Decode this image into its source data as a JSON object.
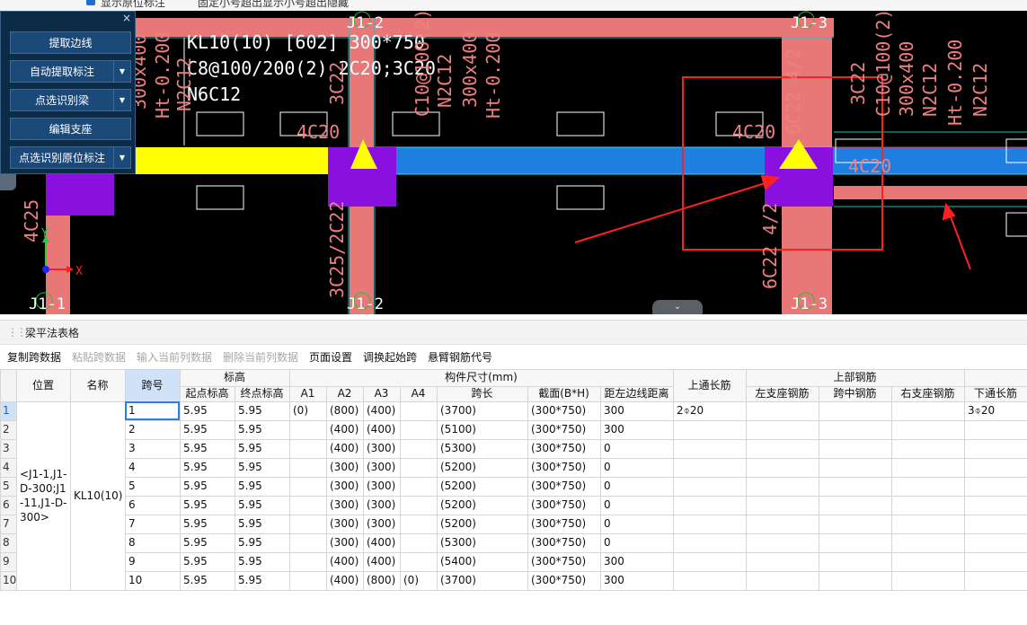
{
  "top_strip": {
    "checkbox_text": "显示原位标注",
    "text2": "固定小号超出显示小号超出隐藏"
  },
  "float_panel": {
    "buttons": [
      {
        "label": "提取边线",
        "dropdown": false
      },
      {
        "label": "自动提取标注",
        "dropdown": true
      },
      {
        "label": "点选识别梁",
        "dropdown": true
      },
      {
        "label": "编辑支座",
        "dropdown": false
      },
      {
        "label": "点选识别原位标注",
        "dropdown": true
      }
    ],
    "close_glyph": "×"
  },
  "cad": {
    "beam_text": [
      "KL10(10) [602] 300*750",
      "C8@100/200(2) 2C20;3C20",
      "N6C12"
    ],
    "axis_labels": [
      "J1-2",
      "J1-3",
      "J1-1",
      "J1-2",
      "J1-3"
    ],
    "rebar_labels": [
      "4C20",
      "4C20",
      "4C20",
      "4C25",
      "3C25/2C22",
      "6C22 4/2",
      "6C22 4/2",
      "3C22",
      "C10@100(2)",
      "N2C12",
      "300x400",
      "Ht-0.200",
      "300x400",
      "Ht-0.200",
      "N2C12",
      "3C22",
      "C10@100(2)",
      "300x400",
      "N2C12",
      "Ht-0.200",
      "N2C12"
    ],
    "axis_x": "X",
    "axis_y": "Y"
  },
  "panel": {
    "title": "梁平法表格",
    "collapse_glyph": "⌄",
    "side_glyph": "‹"
  },
  "toolbar": [
    {
      "label": "复制跨数据",
      "enabled": true
    },
    {
      "label": "粘贴跨数据",
      "enabled": false
    },
    {
      "label": "输入当前列数据",
      "enabled": false
    },
    {
      "label": "删除当前列数据",
      "enabled": false
    },
    {
      "label": "页面设置",
      "enabled": true
    },
    {
      "label": "调换起始跨",
      "enabled": true
    },
    {
      "label": "悬臂钢筋代号",
      "enabled": true
    }
  ],
  "table": {
    "group_headers": {
      "elevation": "标高",
      "dims": "构件尺寸(mm)",
      "top_rebar": "上部钢筋"
    },
    "headers": {
      "position": "位置",
      "name": "名称",
      "span": "跨号",
      "start_elev": "起点标高",
      "end_elev": "终点标高",
      "a1": "A1",
      "a2": "A2",
      "a3": "A3",
      "a4": "A4",
      "span_len": "跨长",
      "section": "截面(B*H)",
      "edge_dist": "距左边线距离",
      "top_through": "上通长筋",
      "left_support": "左支座钢筋",
      "mid_span": "跨中钢筋",
      "right_support": "右支座钢筋",
      "bottom_through": "下通长筋"
    },
    "position_value": "<J1-1,J1-D-300;J1-11,J1-D-300>",
    "name_value": "KL10(10)",
    "rows": [
      {
        "span": "1",
        "start": "5.95",
        "end": "5.95",
        "a1": "(0)",
        "a2": "(800)",
        "a3": "(400)",
        "a4": "",
        "len": "(3700)",
        "sec": "(300*750)",
        "dist": "300",
        "top": "2⌽20",
        "bottom": "3⌽20"
      },
      {
        "span": "2",
        "start": "5.95",
        "end": "5.95",
        "a1": "",
        "a2": "(400)",
        "a3": "(400)",
        "a4": "",
        "len": "(5100)",
        "sec": "(300*750)",
        "dist": "300",
        "top": "",
        "bottom": ""
      },
      {
        "span": "3",
        "start": "5.95",
        "end": "5.95",
        "a1": "",
        "a2": "(400)",
        "a3": "(300)",
        "a4": "",
        "len": "(5300)",
        "sec": "(300*750)",
        "dist": "0",
        "top": "",
        "bottom": ""
      },
      {
        "span": "4",
        "start": "5.95",
        "end": "5.95",
        "a1": "",
        "a2": "(300)",
        "a3": "(300)",
        "a4": "",
        "len": "(5200)",
        "sec": "(300*750)",
        "dist": "0",
        "top": "",
        "bottom": ""
      },
      {
        "span": "5",
        "start": "5.95",
        "end": "5.95",
        "a1": "",
        "a2": "(300)",
        "a3": "(300)",
        "a4": "",
        "len": "(5200)",
        "sec": "(300*750)",
        "dist": "0",
        "top": "",
        "bottom": ""
      },
      {
        "span": "6",
        "start": "5.95",
        "end": "5.95",
        "a1": "",
        "a2": "(300)",
        "a3": "(300)",
        "a4": "",
        "len": "(5200)",
        "sec": "(300*750)",
        "dist": "0",
        "top": "",
        "bottom": ""
      },
      {
        "span": "7",
        "start": "5.95",
        "end": "5.95",
        "a1": "",
        "a2": "(300)",
        "a3": "(300)",
        "a4": "",
        "len": "(5200)",
        "sec": "(300*750)",
        "dist": "0",
        "top": "",
        "bottom": ""
      },
      {
        "span": "8",
        "start": "5.95",
        "end": "5.95",
        "a1": "",
        "a2": "(300)",
        "a3": "(400)",
        "a4": "",
        "len": "(5300)",
        "sec": "(300*750)",
        "dist": "0",
        "top": "",
        "bottom": ""
      },
      {
        "span": "9",
        "start": "5.95",
        "end": "5.95",
        "a1": "",
        "a2": "(400)",
        "a3": "(400)",
        "a4": "",
        "len": "(5400)",
        "sec": "(300*750)",
        "dist": "300",
        "top": "",
        "bottom": ""
      },
      {
        "span": "10",
        "start": "5.95",
        "end": "5.95",
        "a1": "",
        "a2": "(400)",
        "a3": "(800)",
        "a4": "(0)",
        "len": "(3700)",
        "sec": "(300*750)",
        "dist": "300",
        "top": "",
        "bottom": ""
      }
    ],
    "row_numbers": [
      "1",
      "2",
      "3",
      "4",
      "5",
      "6",
      "7",
      "8",
      "9",
      "10"
    ]
  },
  "colors": {
    "beam_pink": "#e87878",
    "column_purple": "#8a10e0",
    "beam_blue": "#1f7fe0",
    "beam_yellow": "#ffff00",
    "highlight_red": "#ff2020",
    "selection": "#2f7ce8"
  }
}
